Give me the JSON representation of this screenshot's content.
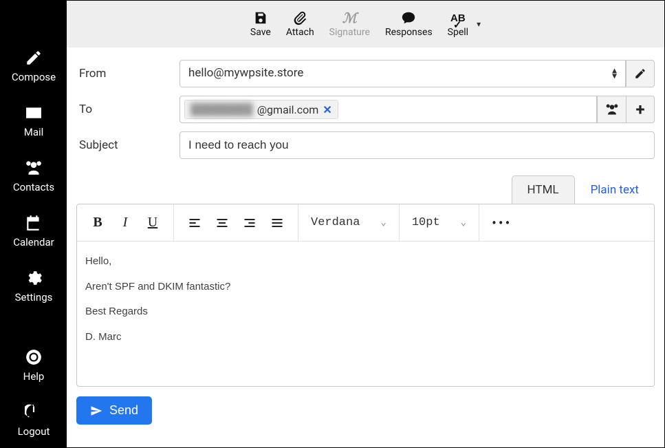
{
  "sidebar": {
    "items": [
      {
        "label": "Compose",
        "icon": "compose-icon"
      },
      {
        "label": "Mail",
        "icon": "mail-icon"
      },
      {
        "label": "Contacts",
        "icon": "contacts-icon"
      },
      {
        "label": "Calendar",
        "icon": "calendar-icon"
      },
      {
        "label": "Settings",
        "icon": "settings-icon"
      }
    ],
    "bottom": [
      {
        "label": "Help",
        "icon": "help-icon"
      },
      {
        "label": "Logout",
        "icon": "logout-icon"
      }
    ]
  },
  "toolbar": {
    "save": "Save",
    "attach": "Attach",
    "signature": "Signature",
    "responses": "Responses",
    "spell": "Spell"
  },
  "fields": {
    "from_label": "From",
    "from_value": "hello@mywpsite.store",
    "to_label": "To",
    "to_recipient_hidden": "████████",
    "to_recipient_domain": "@gmail.com",
    "subject_label": "Subject",
    "subject_value": "I need to reach you"
  },
  "editor": {
    "tabs": {
      "html": "HTML",
      "plain": "Plain text",
      "active": "html"
    },
    "font_family": "Verdana",
    "font_size": "10pt",
    "body_lines": [
      "Hello,",
      "Aren't SPF and DKIM fantastic?",
      "Best Regards",
      "D. Marc"
    ]
  },
  "send": {
    "label": "Send"
  }
}
